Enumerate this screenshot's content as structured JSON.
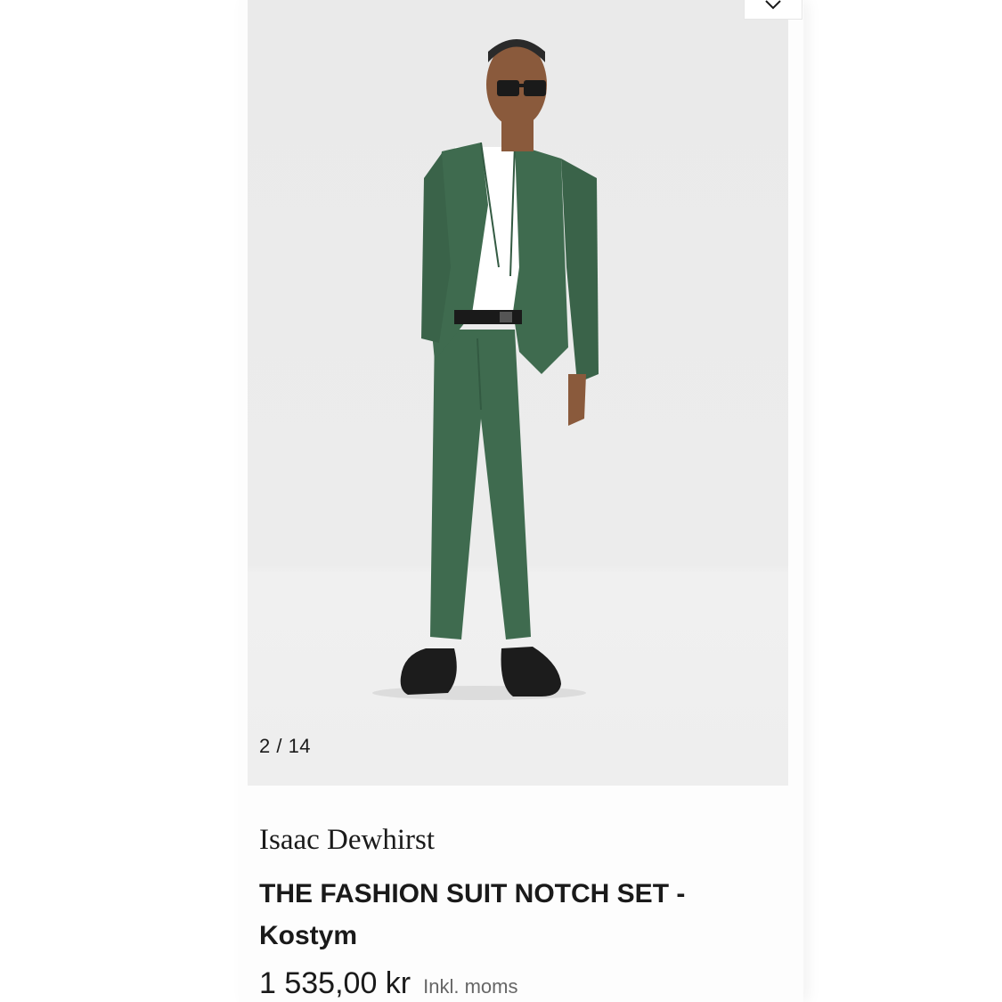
{
  "gallery": {
    "counter": "2 / 14",
    "image_alt": "Model wearing a green suit"
  },
  "product": {
    "brand": "Isaac Dewhirst",
    "title_line1": "THE FASHION SUIT NOTCH SET -",
    "title_line2": "Kostym",
    "price": "1 535,00 kr",
    "vat_note": "Inkl. moms"
  },
  "colors": {
    "suit": "#3f6b4f",
    "background": "#ececec"
  },
  "icons": {
    "wishlist": "heart-icon"
  }
}
